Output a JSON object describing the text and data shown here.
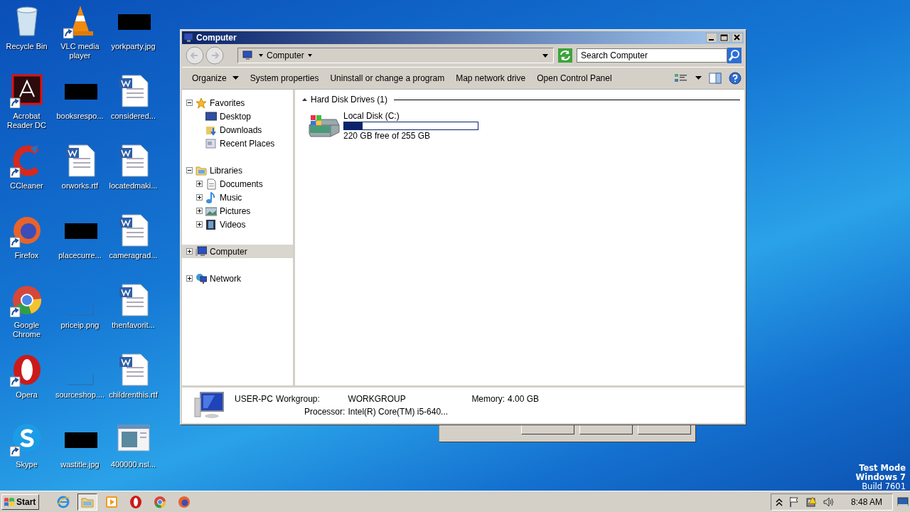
{
  "desktop_icons": [
    {
      "label": "Recycle Bin",
      "kind": "recycle",
      "shortcut": false
    },
    {
      "label": "Acrobat Reader DC",
      "kind": "acrobat",
      "shortcut": true
    },
    {
      "label": "CCleaner",
      "kind": "ccleaner",
      "shortcut": true
    },
    {
      "label": "Firefox",
      "kind": "firefox",
      "shortcut": true
    },
    {
      "label": "Google Chrome",
      "kind": "chrome",
      "shortcut": true
    },
    {
      "label": "Opera",
      "kind": "opera",
      "shortcut": true
    },
    {
      "label": "Skype",
      "kind": "skype",
      "shortcut": true
    },
    {
      "label": "VLC media player",
      "kind": "vlc",
      "shortcut": true
    },
    {
      "label": "booksrespo...",
      "kind": "redacted",
      "shortcut": false
    },
    {
      "label": "orworks.rtf",
      "kind": "document",
      "shortcut": false
    },
    {
      "label": "placecurre...",
      "kind": "redacted",
      "shortcut": false
    },
    {
      "label": "priceip.png",
      "kind": "blank",
      "shortcut": false
    },
    {
      "label": "sourceshop....",
      "kind": "blank",
      "shortcut": false
    },
    {
      "label": "wastitle.jpg",
      "kind": "redacted",
      "shortcut": false
    },
    {
      "label": "yorkparty.jpg",
      "kind": "redacted",
      "shortcut": false
    },
    {
      "label": "considered...",
      "kind": "document",
      "shortcut": false
    },
    {
      "label": "locatedmaki...",
      "kind": "document",
      "shortcut": false
    },
    {
      "label": "cameragrad...",
      "kind": "document",
      "shortcut": false
    },
    {
      "label": "thenfavorit...",
      "kind": "document",
      "shortcut": false
    },
    {
      "label": "childrenthis.rtf",
      "kind": "document",
      "shortcut": false
    },
    {
      "label": "400000.nsl...",
      "kind": "installer",
      "shortcut": false
    }
  ],
  "window": {
    "title": "Computer",
    "address": {
      "crumbs": [
        "Computer"
      ]
    },
    "search": {
      "placeholder": "Search Computer"
    },
    "toolbar": [
      {
        "label": "Organize",
        "dropdown": true
      },
      {
        "label": "System properties",
        "dropdown": false
      },
      {
        "label": "Uninstall or change a program",
        "dropdown": false
      },
      {
        "label": "Map network drive",
        "dropdown": false
      },
      {
        "label": "Open Control Panel",
        "dropdown": false
      }
    ],
    "nav": [
      {
        "label": "Favorites",
        "kind": "star",
        "expanded": true,
        "selected": false,
        "children": [
          {
            "label": "Desktop",
            "kind": "desktop",
            "selected": false
          },
          {
            "label": "Downloads",
            "kind": "downloads",
            "selected": false
          },
          {
            "label": "Recent Places",
            "kind": "recent",
            "selected": false
          }
        ]
      },
      {
        "label": "Libraries",
        "kind": "library",
        "expanded": true,
        "selected": false,
        "children": [
          {
            "label": "Documents",
            "kind": "documents",
            "expanded": false,
            "selected": false
          },
          {
            "label": "Music",
            "kind": "music",
            "expanded": false,
            "selected": false
          },
          {
            "label": "Pictures",
            "kind": "pictures",
            "expanded": false,
            "selected": false
          },
          {
            "label": "Videos",
            "kind": "videos",
            "expanded": false,
            "selected": false
          }
        ]
      },
      {
        "label": "Computer",
        "kind": "computer",
        "expanded": false,
        "selected": true
      },
      {
        "label": "Network",
        "kind": "network",
        "expanded": false,
        "selected": false
      }
    ],
    "groups": [
      {
        "title": "Hard Disk Drives (1)",
        "expanded": true,
        "drives": [
          {
            "name": "Local Disk (C:)",
            "level": 0.137,
            "reading": "220 GB free of 255 GB"
          }
        ]
      }
    ],
    "details": {
      "name": "USER-PC",
      "workgroup_label": "Workgroup:",
      "workgroup": "WORKGROUP",
      "memory_label": "Memory:",
      "memory": "4.00 GB",
      "processor_label": "Processor:",
      "processor": "Intel(R) Core(TM) i5-640..."
    }
  },
  "taskbar": {
    "start": "Start",
    "items": [
      {
        "kind": "ie",
        "selected": false
      },
      {
        "kind": "explorer",
        "selected": true
      },
      {
        "kind": "media",
        "selected": false
      },
      {
        "kind": "opera",
        "selected": false
      },
      {
        "kind": "chrome",
        "selected": false
      },
      {
        "kind": "firefox",
        "selected": false
      }
    ],
    "clock": "8:48 AM"
  },
  "watermark_lines": [
    {
      "text": "Test Mode",
      "bold": true
    },
    {
      "text": "Windows 7",
      "bold": true
    },
    {
      "text": "Build 7601",
      "bold": false
    }
  ]
}
